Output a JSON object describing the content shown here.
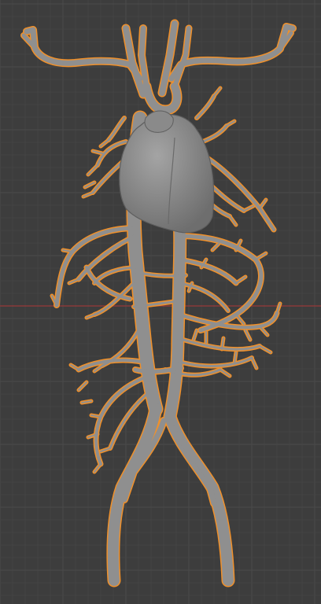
{
  "viewport": {
    "background": "#3d3d3d",
    "grid_minor": "#444444",
    "grid_major": "#4a4a4a",
    "x_axis_color": "#8a3a3a",
    "selection_outline_color": "#f0902a",
    "mesh_color": "#8f8f8f",
    "mesh_shade": "#7a7a7a"
  },
  "objects": [
    {
      "name": "heart",
      "selected": false
    },
    {
      "name": "vessel-tree",
      "selected": true
    }
  ]
}
